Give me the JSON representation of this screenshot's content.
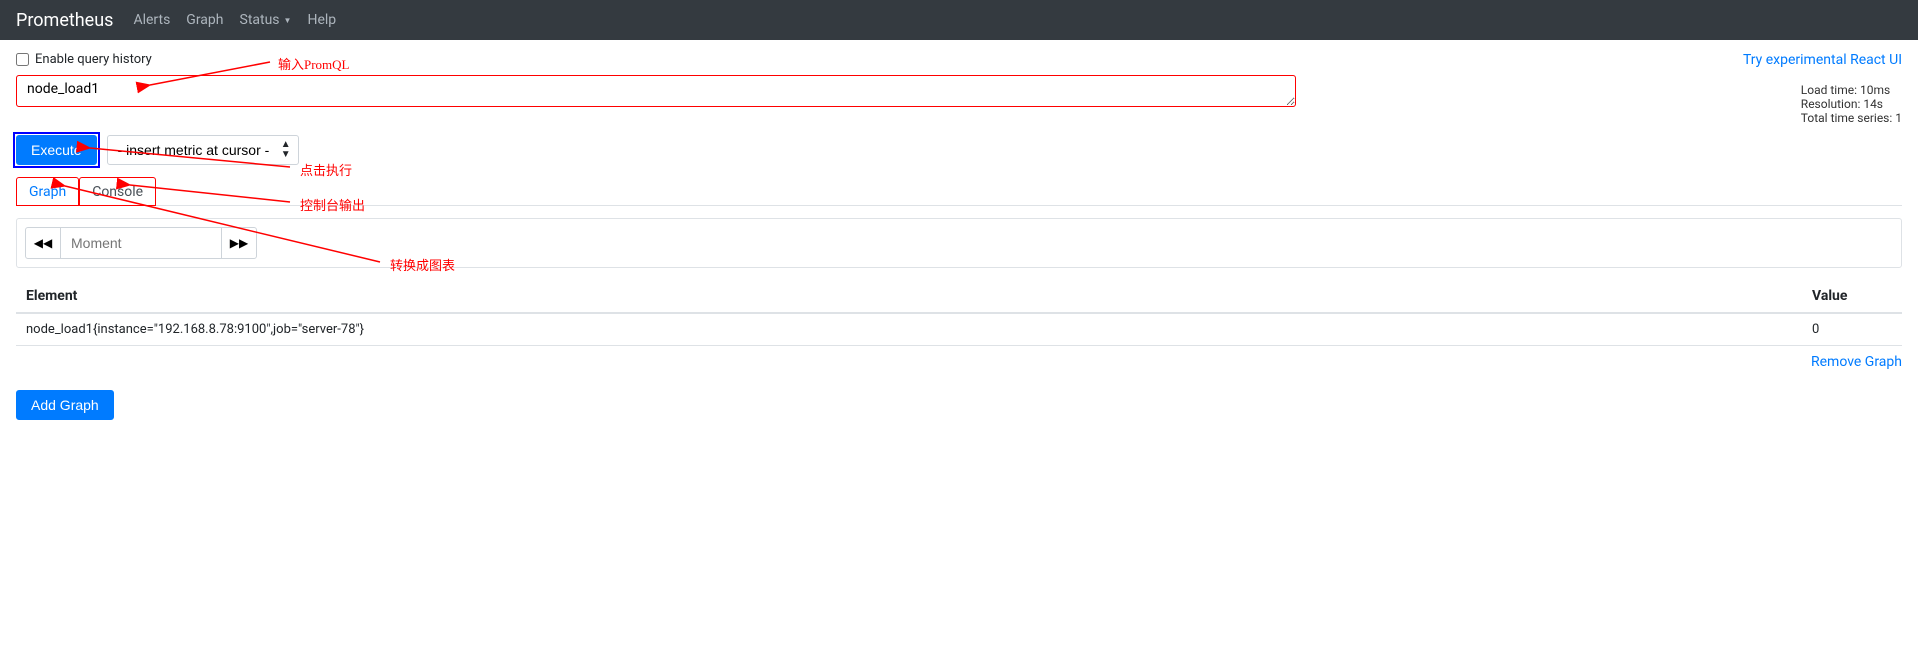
{
  "navbar": {
    "brand": "Prometheus",
    "links": {
      "alerts": "Alerts",
      "graph": "Graph",
      "status": "Status",
      "help": "Help"
    }
  },
  "checkbox": {
    "label": "Enable query history"
  },
  "react_link": "Try experimental React UI",
  "query": {
    "value": "node_load1"
  },
  "stats": {
    "load_time": "Load time: 10ms",
    "resolution": "Resolution: 14s",
    "total_series": "Total time series: 1"
  },
  "execute_label": "Execute",
  "metric_select_placeholder": "- insert metric at cursor -",
  "tabs": {
    "graph": "Graph",
    "console": "Console"
  },
  "moment_placeholder": "Moment",
  "table": {
    "header_element": "Element",
    "header_value": "Value",
    "rows": [
      {
        "element": "node_load1{instance=\"192.168.8.78:9100\",job=\"server-78\"}",
        "value": "0"
      }
    ]
  },
  "remove_graph": "Remove Graph",
  "add_graph": "Add Graph",
  "annotations": {
    "a1": "输入PromQL",
    "a2": "点击执行",
    "a3": "控制台输出",
    "a4": "转换成图表"
  }
}
